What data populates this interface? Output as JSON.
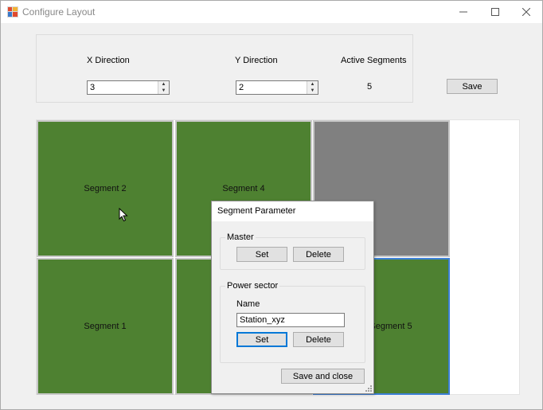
{
  "window": {
    "title": "Configure Layout",
    "minimize_icon": "minimize-icon",
    "maximize_icon": "maximize-icon",
    "close_icon": "close-icon"
  },
  "controls": {
    "x_direction_label": "X Direction",
    "x_direction_value": "3",
    "y_direction_label": "Y Direction",
    "y_direction_value": "2",
    "active_segments_label": "Active Segments",
    "active_segments_value": "5",
    "save_label": "Save"
  },
  "segments": {
    "top_left": "Segment 2",
    "top_middle": "Segment 4",
    "bottom_left": "Segment 1",
    "bottom_right": "Segment 5",
    "active_color": "#4e8131",
    "inactive_color": "#808080"
  },
  "dialog": {
    "title": "Segment Parameter",
    "master": {
      "group_label": "Master",
      "set_label": "Set",
      "delete_label": "Delete"
    },
    "power_sector": {
      "group_label": "Power sector",
      "name_label": "Name",
      "name_value": "Station_xyz",
      "set_label": "Set",
      "delete_label": "Delete"
    },
    "save_close_label": "Save and close"
  }
}
